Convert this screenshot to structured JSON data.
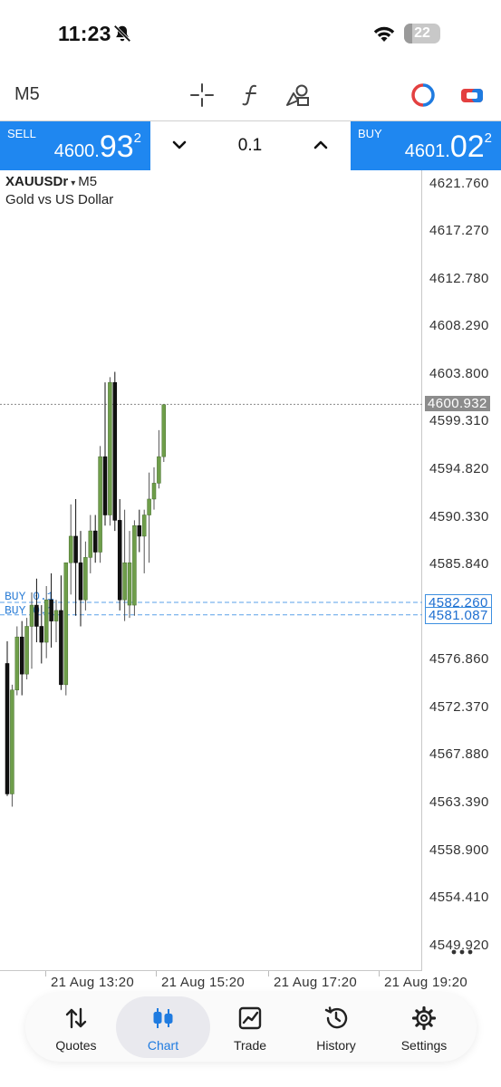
{
  "status_bar": {
    "time": "11:23",
    "battery_level": "22",
    "icons": [
      "bell-slash-icon",
      "wifi-icon",
      "battery-icon"
    ]
  },
  "toolbar": {
    "timeframe": "M5",
    "icons": [
      "crosshair-icon",
      "function-icon",
      "objects-icon",
      "trade-circle-icon",
      "one-click-trading-icon"
    ]
  },
  "trade_panel": {
    "sell_label": "SELL",
    "sell_price_small": "4600.",
    "sell_price_big": "93",
    "sell_price_sup": "2",
    "buy_label": "BUY",
    "buy_price_small": "4601.",
    "buy_price_big": "02",
    "buy_price_sup": "2",
    "lot": "0.1",
    "colors": {
      "sell": "#1f87f0",
      "buy": "#1f87f0"
    }
  },
  "chart": {
    "symbol": "XAUUSDr",
    "timeframe": "M5",
    "description": "Gold vs US Dollar",
    "price_ticks": [
      "4621.760",
      "4617.270",
      "4612.780",
      "4608.290",
      "4603.800",
      "4599.310",
      "4594.820",
      "4590.330",
      "4585.840",
      "4581.087",
      "4576.860",
      "4572.370",
      "4567.880",
      "4563.390",
      "4558.900",
      "4554.410",
      "4549.920"
    ],
    "current_price": "4600.932",
    "order_prices": [
      "4582.260",
      "4581.087"
    ],
    "order_labels": [
      "BUY 0.1",
      "BUY 0.1"
    ],
    "time_labels": [
      "21 Aug 13:20",
      "21 Aug 15:20",
      "21 Aug 17:20",
      "21 Aug 19:20"
    ],
    "colors": {
      "bull": "#6f9e4a",
      "bear": "#111111",
      "order_line": "#5aa0e8",
      "current_line": "#888888"
    }
  },
  "chart_data": {
    "type": "candlestick",
    "title": "",
    "symbol": "XAUUSDr",
    "timeframe": "M5",
    "ylim": [
      4547.5,
      4623.0
    ],
    "candles": [
      {
        "o": 4576.5,
        "h": 4578.6,
        "l": 4564.0,
        "c": 4564.2,
        "dir": "bear"
      },
      {
        "o": 4564.2,
        "h": 4574.5,
        "l": 4563.0,
        "c": 4574.0,
        "dir": "bull"
      },
      {
        "o": 4574.0,
        "h": 4580.0,
        "l": 4573.5,
        "c": 4579.0,
        "dir": "bull"
      },
      {
        "o": 4579.0,
        "h": 4580.5,
        "l": 4573.5,
        "c": 4575.5,
        "dir": "bear"
      },
      {
        "o": 4575.5,
        "h": 4580.8,
        "l": 4575.0,
        "c": 4580.0,
        "dir": "bull"
      },
      {
        "o": 4580.0,
        "h": 4583.2,
        "l": 4576.0,
        "c": 4582.0,
        "dir": "bull"
      },
      {
        "o": 4582.0,
        "h": 4584.5,
        "l": 4578.5,
        "c": 4580.0,
        "dir": "bear"
      },
      {
        "o": 4580.0,
        "h": 4582.0,
        "l": 4576.5,
        "c": 4578.5,
        "dir": "bear"
      },
      {
        "o": 4578.5,
        "h": 4583.8,
        "l": 4577.0,
        "c": 4582.5,
        "dir": "bull"
      },
      {
        "o": 4582.5,
        "h": 4585.0,
        "l": 4578.0,
        "c": 4580.5,
        "dir": "bear"
      },
      {
        "o": 4580.5,
        "h": 4582.5,
        "l": 4578.5,
        "c": 4581.5,
        "dir": "bull"
      },
      {
        "o": 4581.5,
        "h": 4584.8,
        "l": 4574.0,
        "c": 4574.5,
        "dir": "bear"
      },
      {
        "o": 4574.5,
        "h": 4586.0,
        "l": 4573.5,
        "c": 4586.0,
        "dir": "bull"
      },
      {
        "o": 4586.0,
        "h": 4591.5,
        "l": 4583.0,
        "c": 4588.5,
        "dir": "bull"
      },
      {
        "o": 4588.5,
        "h": 4592.0,
        "l": 4581.0,
        "c": 4586.0,
        "dir": "bear"
      },
      {
        "o": 4586.0,
        "h": 4589.0,
        "l": 4580.0,
        "c": 4582.5,
        "dir": "bear"
      },
      {
        "o": 4582.5,
        "h": 4588.0,
        "l": 4581.5,
        "c": 4586.5,
        "dir": "bull"
      },
      {
        "o": 4586.5,
        "h": 4590.5,
        "l": 4585.0,
        "c": 4589.0,
        "dir": "bull"
      },
      {
        "o": 4589.0,
        "h": 4590.5,
        "l": 4586.0,
        "c": 4587.0,
        "dir": "bear"
      },
      {
        "o": 4587.0,
        "h": 4597.0,
        "l": 4586.0,
        "c": 4596.0,
        "dir": "bull"
      },
      {
        "o": 4596.0,
        "h": 4603.0,
        "l": 4589.5,
        "c": 4590.5,
        "dir": "bear"
      },
      {
        "o": 4590.5,
        "h": 4603.5,
        "l": 4589.5,
        "c": 4603.0,
        "dir": "bull"
      },
      {
        "o": 4603.0,
        "h": 4604.0,
        "l": 4589.0,
        "c": 4590.0,
        "dir": "bear"
      },
      {
        "o": 4590.0,
        "h": 4592.0,
        "l": 4581.5,
        "c": 4582.5,
        "dir": "bear"
      },
      {
        "o": 4582.5,
        "h": 4591.0,
        "l": 4580.5,
        "c": 4586.0,
        "dir": "bull"
      },
      {
        "o": 4586.0,
        "h": 4589.0,
        "l": 4580.8,
        "c": 4582.0,
        "dir": "bull"
      },
      {
        "o": 4582.0,
        "h": 4590.0,
        "l": 4581.0,
        "c": 4589.5,
        "dir": "bull"
      },
      {
        "o": 4589.5,
        "h": 4591.0,
        "l": 4587.0,
        "c": 4588.5,
        "dir": "bear"
      },
      {
        "o": 4588.5,
        "h": 4591.0,
        "l": 4585.0,
        "c": 4590.5,
        "dir": "bull"
      },
      {
        "o": 4590.5,
        "h": 4594.5,
        "l": 4586.0,
        "c": 4592.0,
        "dir": "bull"
      },
      {
        "o": 4592.0,
        "h": 4595.0,
        "l": 4591.0,
        "c": 4593.5,
        "dir": "bull"
      },
      {
        "o": 4593.5,
        "h": 4598.5,
        "l": 4593.0,
        "c": 4596.0,
        "dir": "bull"
      },
      {
        "o": 4596.0,
        "h": 4600.9,
        "l": 4595.5,
        "c": 4600.9,
        "dir": "bull"
      }
    ]
  },
  "bottom_nav": {
    "items": [
      {
        "label": "Quotes",
        "icon": "quotes-arrows-icon",
        "active": false
      },
      {
        "label": "Chart",
        "icon": "chart-candles-icon",
        "active": true
      },
      {
        "label": "Trade",
        "icon": "trade-chart-icon",
        "active": false
      },
      {
        "label": "History",
        "icon": "history-clock-icon",
        "active": false
      },
      {
        "label": "Settings",
        "icon": "settings-gear-icon",
        "active": false
      }
    ],
    "active_color": "#1f7be0"
  }
}
